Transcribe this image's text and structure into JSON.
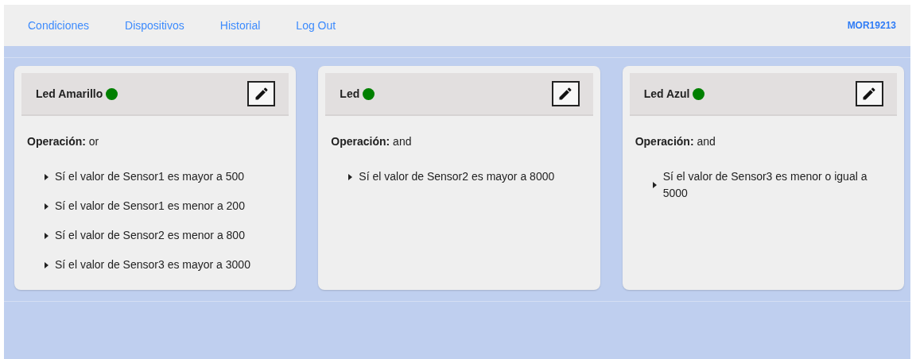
{
  "nav": {
    "links": [
      "Condiciones",
      "Dispositivos",
      "Historial",
      "Log Out"
    ],
    "user": "MOR19213"
  },
  "cards": [
    {
      "title": "Led Amarillo",
      "active": true,
      "operation_label": "Operación:",
      "operation": "or",
      "conditions": [
        "Sí el valor de Sensor1 es mayor a 500",
        "Sí el valor de Sensor1 es menor a 200",
        "Sí el valor de Sensor2 es menor a 800",
        "Sí el valor de Sensor3 es mayor a 3000"
      ]
    },
    {
      "title": "Led",
      "active": true,
      "operation_label": "Operación:",
      "operation": "and",
      "conditions": [
        "Sí el valor de Sensor2 es mayor a 8000"
      ]
    },
    {
      "title": "Led Azul",
      "active": true,
      "operation_label": "Operación:",
      "operation": "and",
      "conditions": [
        "Sí el valor de Sensor3 es menor o igual a 5000"
      ]
    }
  ]
}
